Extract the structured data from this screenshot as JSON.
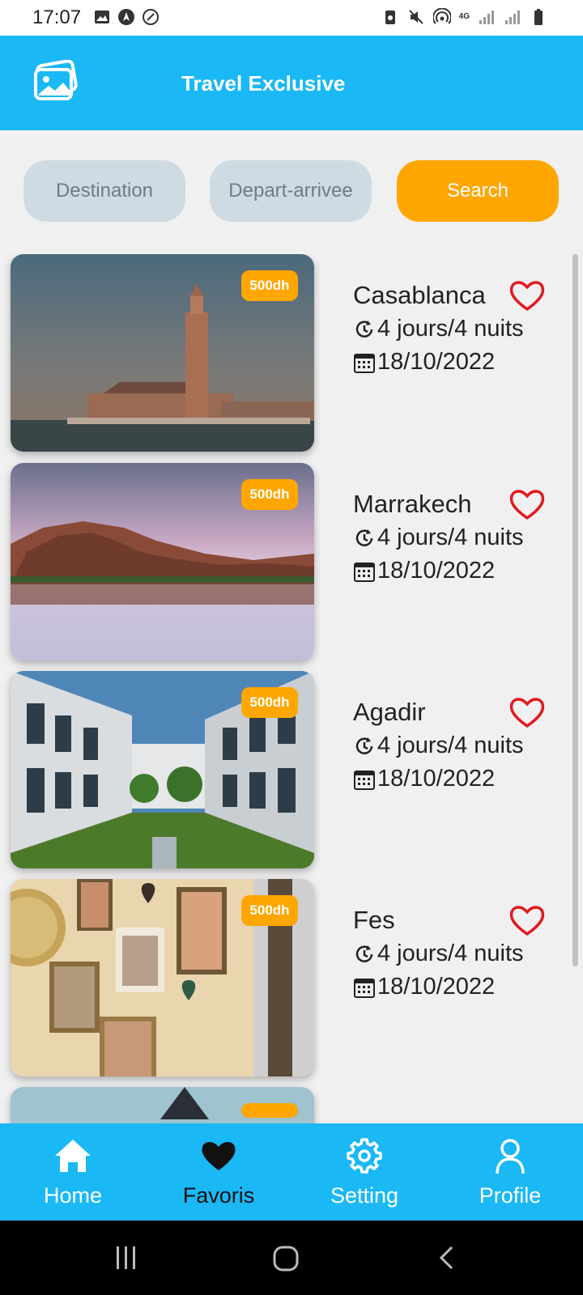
{
  "status_bar": {
    "time": "17:07",
    "left_icons": [
      "image-icon",
      "navigation-icon",
      "cast-icon"
    ],
    "right_icons": [
      "battery-saver-icon",
      "mute-icon",
      "hotspot-icon",
      "4g-icon",
      "signal-icon",
      "signal-icon",
      "battery-icon"
    ],
    "network_label": "4G"
  },
  "app_bar": {
    "title": "Travel Exclusive",
    "logo_icon": "photos-icon"
  },
  "search": {
    "destination_placeholder": "Destination",
    "depart_placeholder": "Depart-arrivee",
    "search_label": "Search"
  },
  "trips": [
    {
      "city": "Casablanca",
      "price": "500dh",
      "duration": "4 jours/4 nuits",
      "date": "18/10/2022",
      "favorite": false
    },
    {
      "city": "Marrakech",
      "price": "500dh",
      "duration": "4 jours/4 nuits",
      "date": "18/10/2022",
      "favorite": false
    },
    {
      "city": "Agadir",
      "price": "500dh",
      "duration": "4 jours/4 nuits",
      "date": "18/10/2022",
      "favorite": false
    },
    {
      "city": "Fes",
      "price": "500dh",
      "duration": "4 jours/4 nuits",
      "date": "18/10/2022",
      "favorite": false
    }
  ],
  "bottom_nav": {
    "items": [
      {
        "label": "Home",
        "icon": "home-icon",
        "active": false
      },
      {
        "label": "Favoris",
        "icon": "heart-icon",
        "active": true
      },
      {
        "label": "Setting",
        "icon": "gear-icon",
        "active": false
      },
      {
        "label": "Profile",
        "icon": "user-icon",
        "active": false
      }
    ]
  },
  "colors": {
    "primary": "#1ab8f5",
    "accent": "#ffa600",
    "heart": "#e0191f",
    "input_bg": "#cfdbe2",
    "background": "#f0f0f0"
  }
}
